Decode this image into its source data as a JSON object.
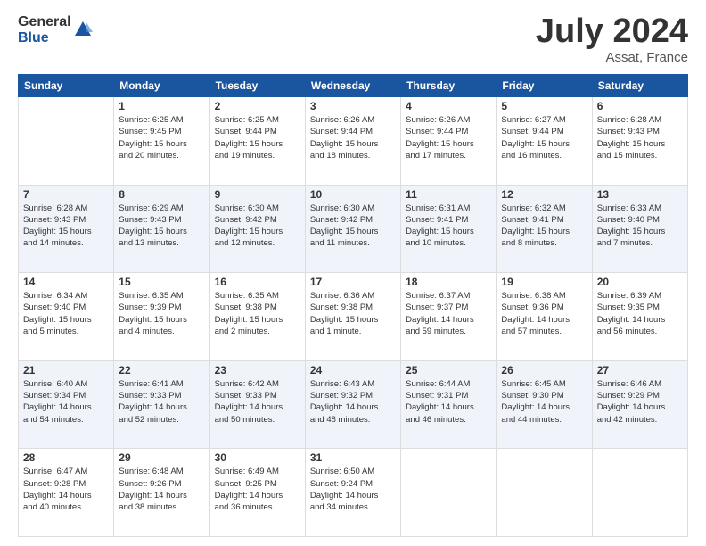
{
  "logo": {
    "general": "General",
    "blue": "Blue"
  },
  "header": {
    "month_year": "July 2024",
    "location": "Assat, France"
  },
  "days_of_week": [
    "Sunday",
    "Monday",
    "Tuesday",
    "Wednesday",
    "Thursday",
    "Friday",
    "Saturday"
  ],
  "weeks": [
    {
      "shaded": false,
      "days": [
        {
          "num": "",
          "info": ""
        },
        {
          "num": "1",
          "info": "Sunrise: 6:25 AM\nSunset: 9:45 PM\nDaylight: 15 hours\nand 20 minutes."
        },
        {
          "num": "2",
          "info": "Sunrise: 6:25 AM\nSunset: 9:44 PM\nDaylight: 15 hours\nand 19 minutes."
        },
        {
          "num": "3",
          "info": "Sunrise: 6:26 AM\nSunset: 9:44 PM\nDaylight: 15 hours\nand 18 minutes."
        },
        {
          "num": "4",
          "info": "Sunrise: 6:26 AM\nSunset: 9:44 PM\nDaylight: 15 hours\nand 17 minutes."
        },
        {
          "num": "5",
          "info": "Sunrise: 6:27 AM\nSunset: 9:44 PM\nDaylight: 15 hours\nand 16 minutes."
        },
        {
          "num": "6",
          "info": "Sunrise: 6:28 AM\nSunset: 9:43 PM\nDaylight: 15 hours\nand 15 minutes."
        }
      ]
    },
    {
      "shaded": true,
      "days": [
        {
          "num": "7",
          "info": "Sunrise: 6:28 AM\nSunset: 9:43 PM\nDaylight: 15 hours\nand 14 minutes."
        },
        {
          "num": "8",
          "info": "Sunrise: 6:29 AM\nSunset: 9:43 PM\nDaylight: 15 hours\nand 13 minutes."
        },
        {
          "num": "9",
          "info": "Sunrise: 6:30 AM\nSunset: 9:42 PM\nDaylight: 15 hours\nand 12 minutes."
        },
        {
          "num": "10",
          "info": "Sunrise: 6:30 AM\nSunset: 9:42 PM\nDaylight: 15 hours\nand 11 minutes."
        },
        {
          "num": "11",
          "info": "Sunrise: 6:31 AM\nSunset: 9:41 PM\nDaylight: 15 hours\nand 10 minutes."
        },
        {
          "num": "12",
          "info": "Sunrise: 6:32 AM\nSunset: 9:41 PM\nDaylight: 15 hours\nand 8 minutes."
        },
        {
          "num": "13",
          "info": "Sunrise: 6:33 AM\nSunset: 9:40 PM\nDaylight: 15 hours\nand 7 minutes."
        }
      ]
    },
    {
      "shaded": false,
      "days": [
        {
          "num": "14",
          "info": "Sunrise: 6:34 AM\nSunset: 9:40 PM\nDaylight: 15 hours\nand 5 minutes."
        },
        {
          "num": "15",
          "info": "Sunrise: 6:35 AM\nSunset: 9:39 PM\nDaylight: 15 hours\nand 4 minutes."
        },
        {
          "num": "16",
          "info": "Sunrise: 6:35 AM\nSunset: 9:38 PM\nDaylight: 15 hours\nand 2 minutes."
        },
        {
          "num": "17",
          "info": "Sunrise: 6:36 AM\nSunset: 9:38 PM\nDaylight: 15 hours\nand 1 minute."
        },
        {
          "num": "18",
          "info": "Sunrise: 6:37 AM\nSunset: 9:37 PM\nDaylight: 14 hours\nand 59 minutes."
        },
        {
          "num": "19",
          "info": "Sunrise: 6:38 AM\nSunset: 9:36 PM\nDaylight: 14 hours\nand 57 minutes."
        },
        {
          "num": "20",
          "info": "Sunrise: 6:39 AM\nSunset: 9:35 PM\nDaylight: 14 hours\nand 56 minutes."
        }
      ]
    },
    {
      "shaded": true,
      "days": [
        {
          "num": "21",
          "info": "Sunrise: 6:40 AM\nSunset: 9:34 PM\nDaylight: 14 hours\nand 54 minutes."
        },
        {
          "num": "22",
          "info": "Sunrise: 6:41 AM\nSunset: 9:33 PM\nDaylight: 14 hours\nand 52 minutes."
        },
        {
          "num": "23",
          "info": "Sunrise: 6:42 AM\nSunset: 9:33 PM\nDaylight: 14 hours\nand 50 minutes."
        },
        {
          "num": "24",
          "info": "Sunrise: 6:43 AM\nSunset: 9:32 PM\nDaylight: 14 hours\nand 48 minutes."
        },
        {
          "num": "25",
          "info": "Sunrise: 6:44 AM\nSunset: 9:31 PM\nDaylight: 14 hours\nand 46 minutes."
        },
        {
          "num": "26",
          "info": "Sunrise: 6:45 AM\nSunset: 9:30 PM\nDaylight: 14 hours\nand 44 minutes."
        },
        {
          "num": "27",
          "info": "Sunrise: 6:46 AM\nSunset: 9:29 PM\nDaylight: 14 hours\nand 42 minutes."
        }
      ]
    },
    {
      "shaded": false,
      "days": [
        {
          "num": "28",
          "info": "Sunrise: 6:47 AM\nSunset: 9:28 PM\nDaylight: 14 hours\nand 40 minutes."
        },
        {
          "num": "29",
          "info": "Sunrise: 6:48 AM\nSunset: 9:26 PM\nDaylight: 14 hours\nand 38 minutes."
        },
        {
          "num": "30",
          "info": "Sunrise: 6:49 AM\nSunset: 9:25 PM\nDaylight: 14 hours\nand 36 minutes."
        },
        {
          "num": "31",
          "info": "Sunrise: 6:50 AM\nSunset: 9:24 PM\nDaylight: 14 hours\nand 34 minutes."
        },
        {
          "num": "",
          "info": ""
        },
        {
          "num": "",
          "info": ""
        },
        {
          "num": "",
          "info": ""
        }
      ]
    }
  ]
}
